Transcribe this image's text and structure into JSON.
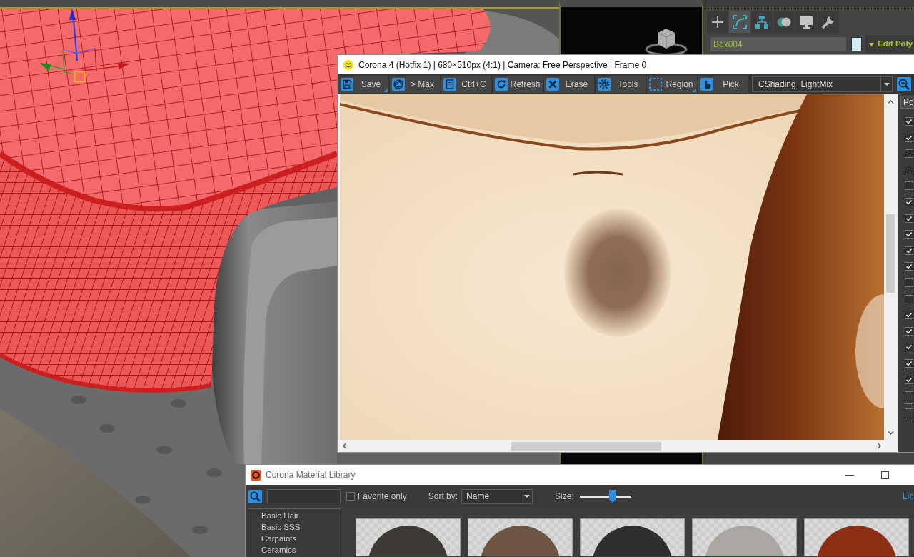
{
  "command_panel": {
    "tabs": [
      {
        "selected": false
      },
      {
        "selected": true
      },
      {
        "selected": false
      },
      {
        "selected": false
      },
      {
        "selected": false
      },
      {
        "selected": false
      }
    ],
    "object_name": "Box004",
    "modifier": "Edit Poly"
  },
  "render_window": {
    "title": "Corona 4 (Hotfix 1) | 680×510px (4:1) | Camera: Free Perspective | Frame 0",
    "toolbar": [
      {
        "label": "Save",
        "menu": true
      },
      {
        "label": "> Max",
        "menu": false
      },
      {
        "label": "Ctrl+C",
        "menu": false
      },
      {
        "label": "Refresh",
        "menu": false
      },
      {
        "label": "Erase",
        "menu": false
      },
      {
        "label": "Tools",
        "menu": false
      },
      {
        "label": "Region",
        "menu": true
      },
      {
        "label": "Pick",
        "menu": false
      }
    ],
    "render_pass": "CShading_LightMix",
    "side_tab": "Po",
    "layers": [
      {
        "checked": true
      },
      {
        "checked": true
      },
      {
        "checked": false
      },
      {
        "checked": false
      },
      {
        "checked": false
      },
      {
        "checked": true
      },
      {
        "checked": true
      },
      {
        "checked": true
      },
      {
        "checked": true
      },
      {
        "checked": true
      },
      {
        "checked": false
      },
      {
        "checked": false
      },
      {
        "checked": true
      },
      {
        "checked": true
      },
      {
        "checked": true
      },
      {
        "checked": true
      },
      {
        "checked": true
      }
    ]
  },
  "material_library": {
    "title": "Corona Material Library",
    "favorite_only": {
      "label": "Favorite only",
      "checked": false
    },
    "sort_label": "Sort by:",
    "sort_value": "Name",
    "size_label": "Size:",
    "size": {
      "level": 0.67
    },
    "link": "Lic",
    "categories": [
      "Basic Hair",
      "Basic SSS",
      "Carpaints",
      "Ceramics"
    ],
    "materials": [
      {
        "color": "#3e3b37"
      },
      {
        "color": "#6e5443"
      },
      {
        "color": "#2f2f2f"
      },
      {
        "color": "#aaa6a1"
      },
      {
        "color": "#8c2f15"
      }
    ]
  }
}
